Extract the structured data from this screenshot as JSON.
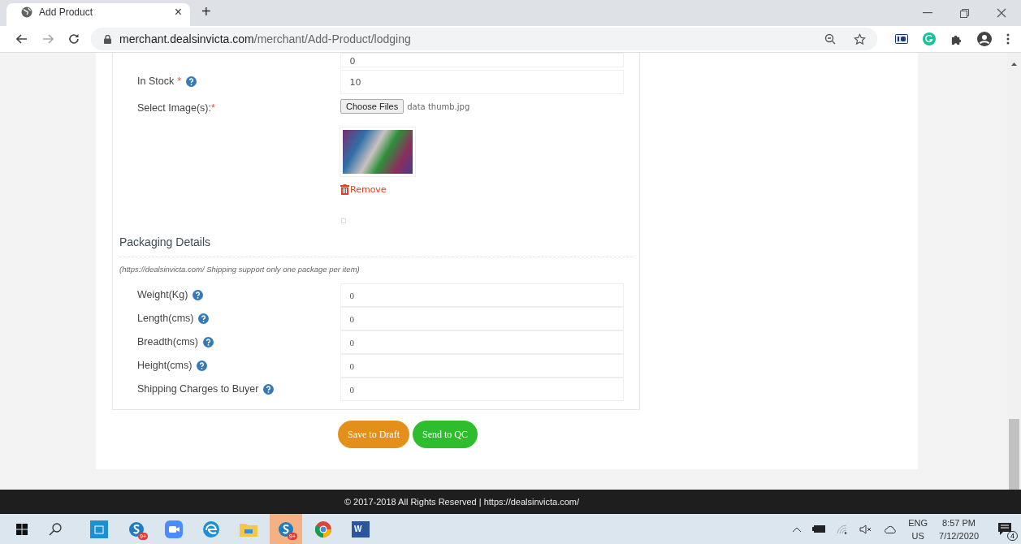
{
  "browser": {
    "tab": {
      "title": "Add Product",
      "close": "×"
    },
    "new_tab": "+",
    "url": {
      "host": "merchant.dealsinvicta.com",
      "path": "/merchant/Add-Product/lodging"
    }
  },
  "form": {
    "partial_field": {
      "value": "0"
    },
    "stock": {
      "label": "In Stock",
      "required": "*",
      "value": "10"
    },
    "images": {
      "label": "Select Image(s):",
      "required": "*",
      "button": "Choose Files",
      "file_name": "data thumb.jpg",
      "remove": "Remove",
      "checkbox": {
        "checked": false
      }
    },
    "packaging": {
      "title": "Packaging Details",
      "note": "(https://dealsinvicta.com/ Shipping support only one package per item)",
      "fields": [
        {
          "label": "Weight(Kg)",
          "value": "0"
        },
        {
          "label": "Length(cms)",
          "value": "0"
        },
        {
          "label": "Breadth(cms)",
          "value": "0"
        },
        {
          "label": "Height(cms)",
          "value": "0"
        },
        {
          "label": "Shipping Charges to Buyer",
          "value": "0"
        }
      ]
    },
    "buttons": [
      {
        "label": "Save to Draft",
        "kind": "draft"
      },
      {
        "label": "Send to QC",
        "kind": "submit"
      }
    ]
  },
  "footer": "© 2017-2018 All Rights Reserved | https://dealsinvicta.com/",
  "taskbar": {
    "apps": [
      {
        "kind": "store",
        "selected": false
      },
      {
        "kind": "skype",
        "badge": "9+",
        "selected": false
      },
      {
        "kind": "zoom",
        "selected": false
      },
      {
        "kind": "edge",
        "selected": false
      },
      {
        "kind": "folder",
        "selected": false
      },
      {
        "kind": "skype",
        "badge": "9+",
        "selected": true
      },
      {
        "kind": "chrome",
        "selected": false
      },
      {
        "kind": "word",
        "label": "W",
        "selected": false
      }
    ],
    "lang": "ENG",
    "region": "US",
    "time": "8:57 PM",
    "date": "7/12/2020",
    "notifications": "4"
  }
}
